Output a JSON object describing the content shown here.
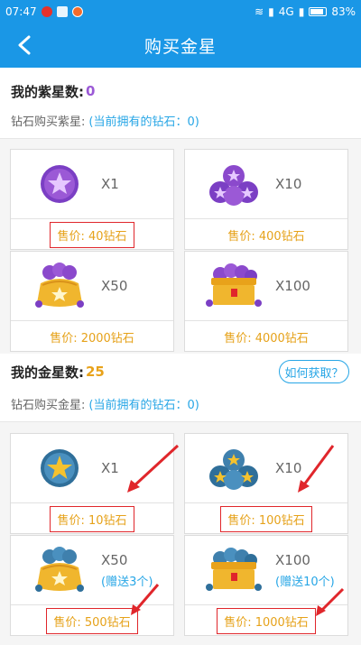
{
  "status": {
    "time": "07:47",
    "network": "4G",
    "battery": "83%"
  },
  "header": {
    "title": "购买金星"
  },
  "purple": {
    "label": "我的紫星数:",
    "count": "0",
    "buy_label": "钻石购买紫星:",
    "diamond_note": "(当前拥有的钻石：0)",
    "items": [
      {
        "qty": "X1",
        "price": "售价: 40钻石",
        "icon": "purple-star-single-icon"
      },
      {
        "qty": "X10",
        "price": "售价: 400钻石",
        "icon": "purple-star-pile-icon"
      },
      {
        "qty": "X50",
        "price": "售价: 2000钻石",
        "icon": "purple-star-bag-icon"
      },
      {
        "qty": "X100",
        "price": "售价: 4000钻石",
        "icon": "purple-star-chest-icon"
      }
    ]
  },
  "gold": {
    "label": "我的金星数:",
    "count": "25",
    "how_to": "如何获取？",
    "buy_label": "钻石购买金星:",
    "diamond_note": "(当前拥有的钻石：0)",
    "items": [
      {
        "qty": "X1",
        "price": "售价: 10钻石",
        "bonus": "",
        "icon": "gold-star-single-icon"
      },
      {
        "qty": "X10",
        "price": "售价: 100钻石",
        "bonus": "",
        "icon": "gold-star-pile-icon"
      },
      {
        "qty": "X50",
        "price": "售价: 500钻石",
        "bonus": "(赠送3个)",
        "icon": "gold-star-bag-icon"
      },
      {
        "qty": "X100",
        "price": "售价: 1000钻石",
        "bonus": "(赠送10个)",
        "icon": "gold-star-chest-icon"
      }
    ]
  },
  "colors": {
    "primary": "#1a97e6",
    "price": "#e6a21a",
    "purple": "#9b59d6",
    "highlight": "#e0262b"
  }
}
